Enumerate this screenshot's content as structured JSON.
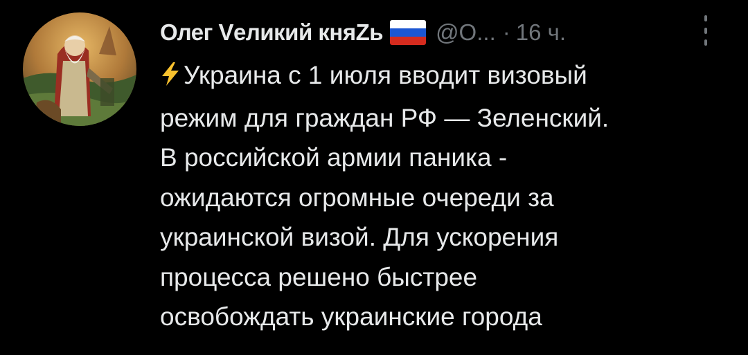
{
  "tweet": {
    "display_name": "Олег Vеликий княZь",
    "handle": "@O...",
    "separator": "·",
    "time": "16 ч.",
    "body_lines": [
      "Украина с 1 июля вводит визовый",
      "режим для граждан РФ — Зеленский.",
      "В российской армии паника -",
      "ожидаются огромные очереди за",
      "украинской визой. Для ускорения",
      "процесса решено быстрее",
      "освобождать украинские города"
    ]
  },
  "icons": {
    "emoji_prefix": "lightning-emoji-icon",
    "name_suffix": "russia-flag-icon",
    "menu": "more-vertical-icon"
  },
  "colors": {
    "background": "#000000",
    "primary_text": "#e7e9ea",
    "secondary_text": "#71767b",
    "lightning": "#f9c22e"
  }
}
